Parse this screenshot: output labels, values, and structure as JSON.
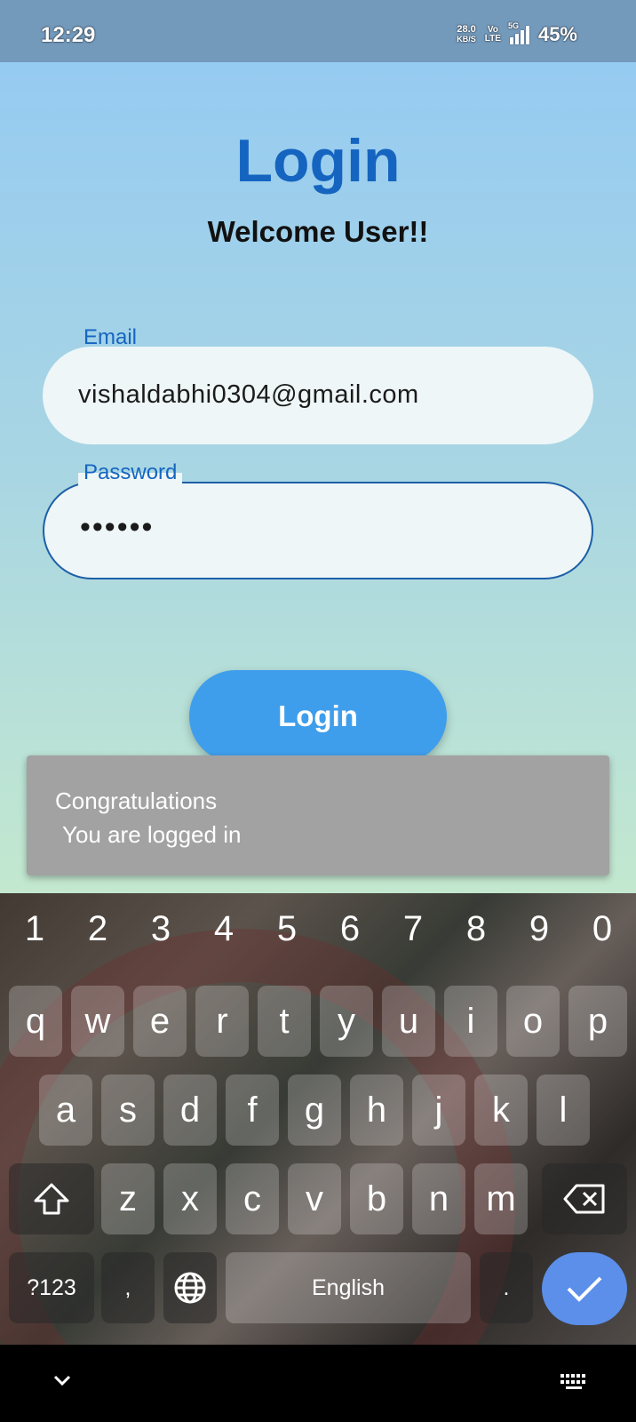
{
  "status_bar": {
    "time": "12:29",
    "net_speed_top": "28.0",
    "net_speed_unit": "KB/S",
    "volte_top": "Vo",
    "volte_bottom": "LTE",
    "network": "5G",
    "battery": "45%"
  },
  "login": {
    "title": "Login",
    "subtitle": "Welcome User!!",
    "email_label": "Email",
    "email_value": "vishaldabhi0304@gmail.com",
    "password_label": "Password",
    "password_value": "••••••",
    "button": "Login"
  },
  "toast": {
    "line1": "Congratulations",
    "line2": "You are logged in"
  },
  "keyboard": {
    "numbers": [
      "1",
      "2",
      "3",
      "4",
      "5",
      "6",
      "7",
      "8",
      "9",
      "0"
    ],
    "row1": [
      "q",
      "w",
      "e",
      "r",
      "t",
      "y",
      "u",
      "i",
      "o",
      "p"
    ],
    "row2": [
      "a",
      "s",
      "d",
      "f",
      "g",
      "h",
      "j",
      "k",
      "l"
    ],
    "row3": [
      "z",
      "x",
      "c",
      "v",
      "b",
      "n",
      "m"
    ],
    "symbols": "?123",
    "comma": ",",
    "space": "English",
    "period": "."
  },
  "icons": {
    "shift": "shift-icon",
    "backspace": "backspace-icon",
    "globe": "globe-icon",
    "enter": "check-icon",
    "nav_down": "chevron-down-icon",
    "nav_keyboard": "keyboard-icon"
  }
}
